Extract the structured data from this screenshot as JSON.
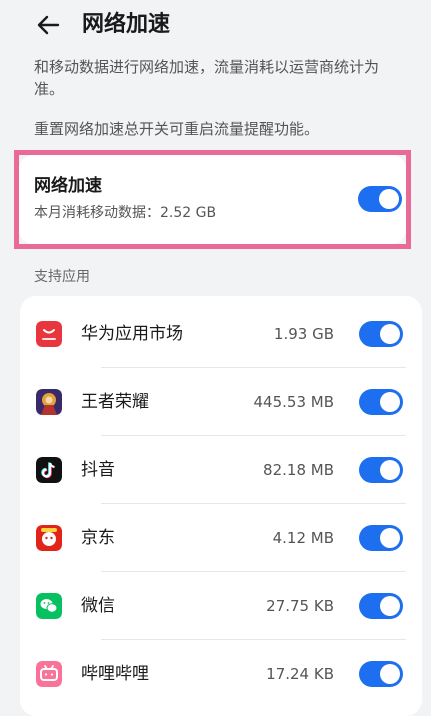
{
  "header": {
    "title": "网络加速"
  },
  "description": {
    "line1": "和移动数据进行网络加速，流量消耗以运营商统计为准。",
    "line2": "重置网络加速总开关可重启流量提醒功能。"
  },
  "main_toggle": {
    "title": "网络加速",
    "subtitle": "本月消耗移动数据：2.52 GB",
    "enabled": true
  },
  "apps_section": {
    "title": "支持应用",
    "apps": [
      {
        "name": "华为应用市场",
        "size": "1.93 GB",
        "enabled": true,
        "icon": "huawei-appgallery-icon"
      },
      {
        "name": "王者荣耀",
        "size": "445.53 MB",
        "enabled": true,
        "icon": "honor-of-kings-icon"
      },
      {
        "name": "抖音",
        "size": "82.18 MB",
        "enabled": true,
        "icon": "douyin-icon"
      },
      {
        "name": "京东",
        "size": "4.12 MB",
        "enabled": true,
        "icon": "jd-icon"
      },
      {
        "name": "微信",
        "size": "27.75 KB",
        "enabled": true,
        "icon": "wechat-icon"
      },
      {
        "name": "哔哩哔哩",
        "size": "17.24 KB",
        "enabled": true,
        "icon": "bilibili-icon"
      }
    ]
  },
  "colors": {
    "accent": "#1e6ff0",
    "highlight": "#e96a96",
    "background": "#f1f3f5"
  }
}
